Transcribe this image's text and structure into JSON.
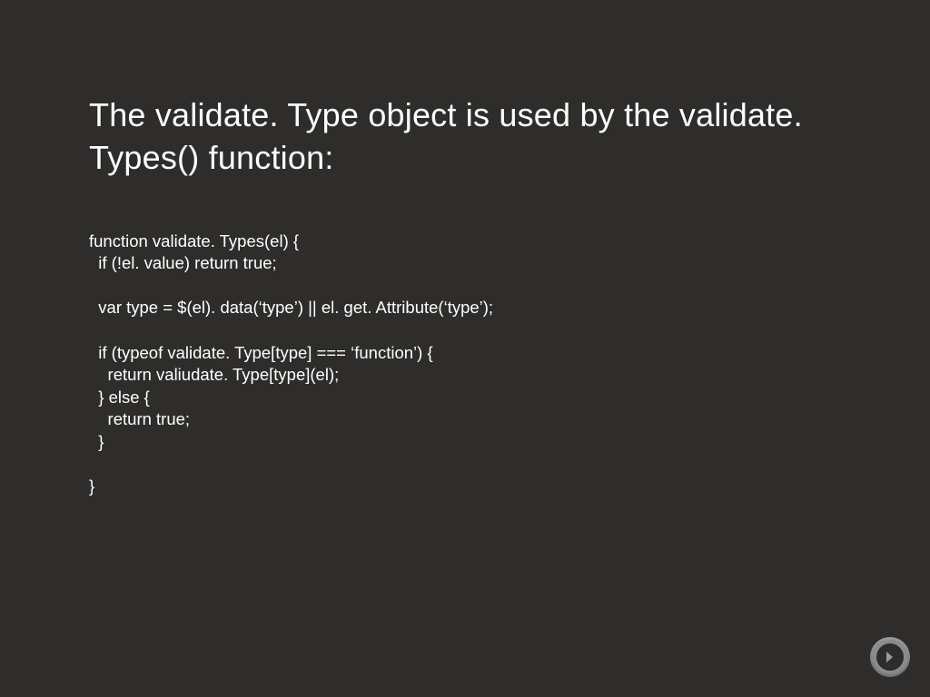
{
  "slide": {
    "title": "The validate. Type object is used by the validate. Types() function:",
    "code": "function validate. Types(el) {\n  if (!el. value) return true;\n\n  var type = $(el). data(‘type’) || el. get. Attribute(‘type’);\n\n  if (typeof validate. Type[type] === ‘function’) {\n    return valiudate. Type[type](el);\n  } else {\n    return true;\n  }\n\n}"
  },
  "controls": {
    "next_label": "Next"
  }
}
